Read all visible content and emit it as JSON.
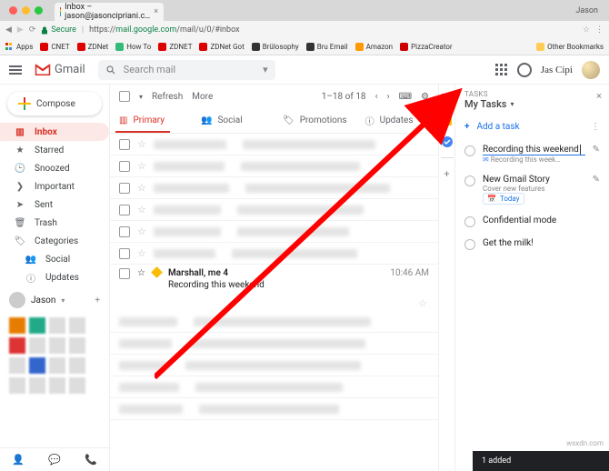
{
  "browser": {
    "tab_title": "Inbox – jason@jasoncipriani.c…",
    "username": "Jason",
    "secure_label": "Secure",
    "url_prefix": "https://",
    "url_host": "mail.google.com",
    "url_path": "/mail/u/0/#inbox",
    "bookmarks": [
      {
        "label": "Apps",
        "color": "#777"
      },
      {
        "label": "CNET",
        "color": "#d00"
      },
      {
        "label": "ZDNet",
        "color": "#d00"
      },
      {
        "label": "How To",
        "color": "#3b7"
      },
      {
        "label": "ZDNET",
        "color": "#d00"
      },
      {
        "label": "ZDNet Got",
        "color": "#d00"
      },
      {
        "label": "Brülosophy",
        "color": "#333"
      },
      {
        "label": "Bru Email",
        "color": "#333"
      },
      {
        "label": "Amazon",
        "color": "#f90"
      },
      {
        "label": "PizzaCreator",
        "color": "#c00"
      }
    ],
    "other_bookmarks": "Other Bookmarks"
  },
  "header": {
    "product": "Gmail",
    "search_placeholder": "Search mail",
    "signature": "Jas Cipi"
  },
  "sidebar": {
    "compose": "Compose",
    "items": [
      {
        "label": "Inbox",
        "icon": "inbox-icon",
        "active": true
      },
      {
        "label": "Starred",
        "icon": "star-icon"
      },
      {
        "label": "Snoozed",
        "icon": "clock-icon"
      },
      {
        "label": "Important",
        "icon": "bookmark-icon"
      },
      {
        "label": "Sent",
        "icon": "send-icon"
      },
      {
        "label": "Trash",
        "icon": "trash-icon"
      },
      {
        "label": "Categories",
        "icon": "tag-icon"
      },
      {
        "label": "Social",
        "icon": "people-icon",
        "indent": true
      },
      {
        "label": "Updates",
        "icon": "info-icon",
        "indent": true
      }
    ],
    "account_name": "Jason"
  },
  "toolbar": {
    "refresh": "Refresh",
    "more": "More",
    "page": "1–18 of 18"
  },
  "tabs": [
    {
      "label": "Primary",
      "icon": "inbox-icon",
      "active": true
    },
    {
      "label": "Social",
      "icon": "people-icon"
    },
    {
      "label": "Promotions",
      "icon": "tag-icon"
    },
    {
      "label": "Updates",
      "icon": "info-icon"
    }
  ],
  "message": {
    "sender": "Marshall, me 4",
    "subject": "Recording this weekend",
    "time": "10:46 AM"
  },
  "tasks": {
    "label": "TASKS",
    "list_name": "My Tasks",
    "add": "Add a task",
    "items": [
      {
        "title": "Recording this weekend",
        "sub": "Recording this week…",
        "editing": true,
        "email": true
      },
      {
        "title": "New Gmail Story",
        "sub": "Cover new features",
        "date": "Today"
      },
      {
        "title": "Confidential mode"
      },
      {
        "title": "Get the milk!"
      }
    ],
    "snackbar": "1 added"
  },
  "watermark": "wsxdn.com"
}
